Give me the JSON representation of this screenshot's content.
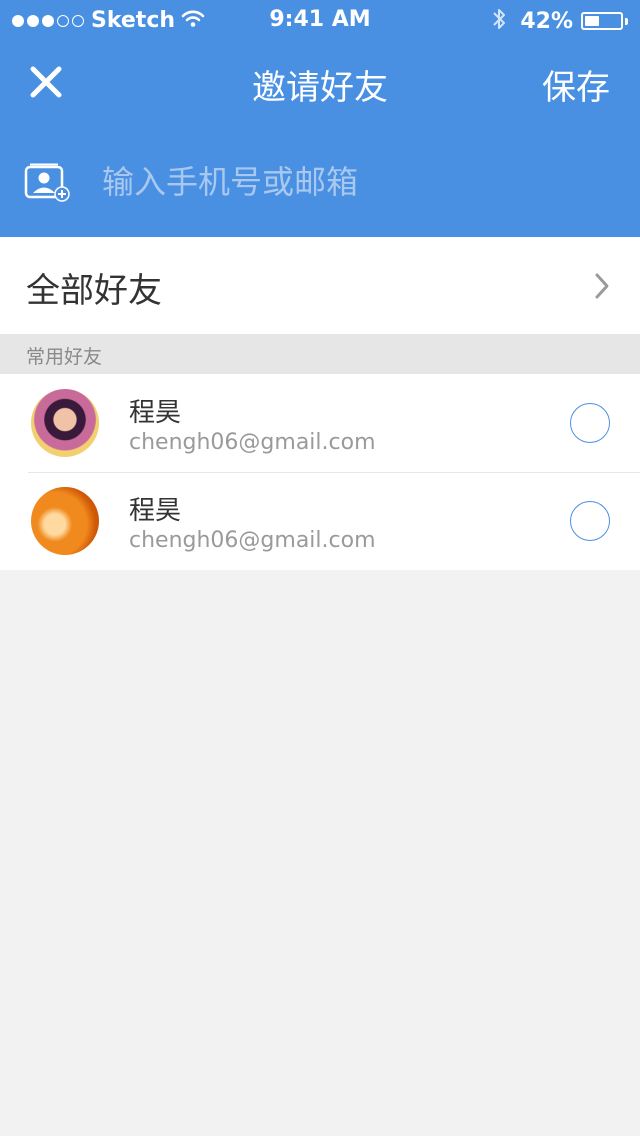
{
  "status_bar": {
    "carrier": "Sketch",
    "time": "9:41 AM",
    "battery_percent": "42%",
    "battery_level": 0.42,
    "signal_strength": 3,
    "signal_total": 5
  },
  "nav": {
    "close_icon": "close-icon",
    "title": "邀请好友",
    "save_label": "保存"
  },
  "search": {
    "icon": "contact-add-icon",
    "placeholder": "输入手机号或邮箱",
    "value": ""
  },
  "all_friends": {
    "label": "全部好友",
    "icon": "chevron-right-icon"
  },
  "section": {
    "title": "常用好友"
  },
  "friends": [
    {
      "name": "程昊",
      "email": "chengh06@gmail.com",
      "selected": false
    },
    {
      "name": "程昊",
      "email": "chengh06@gmail.com",
      "selected": false
    }
  ],
  "colors": {
    "primary": "#4a90e2",
    "background": "#f2f2f2",
    "section_bg": "#e6e6e6"
  }
}
